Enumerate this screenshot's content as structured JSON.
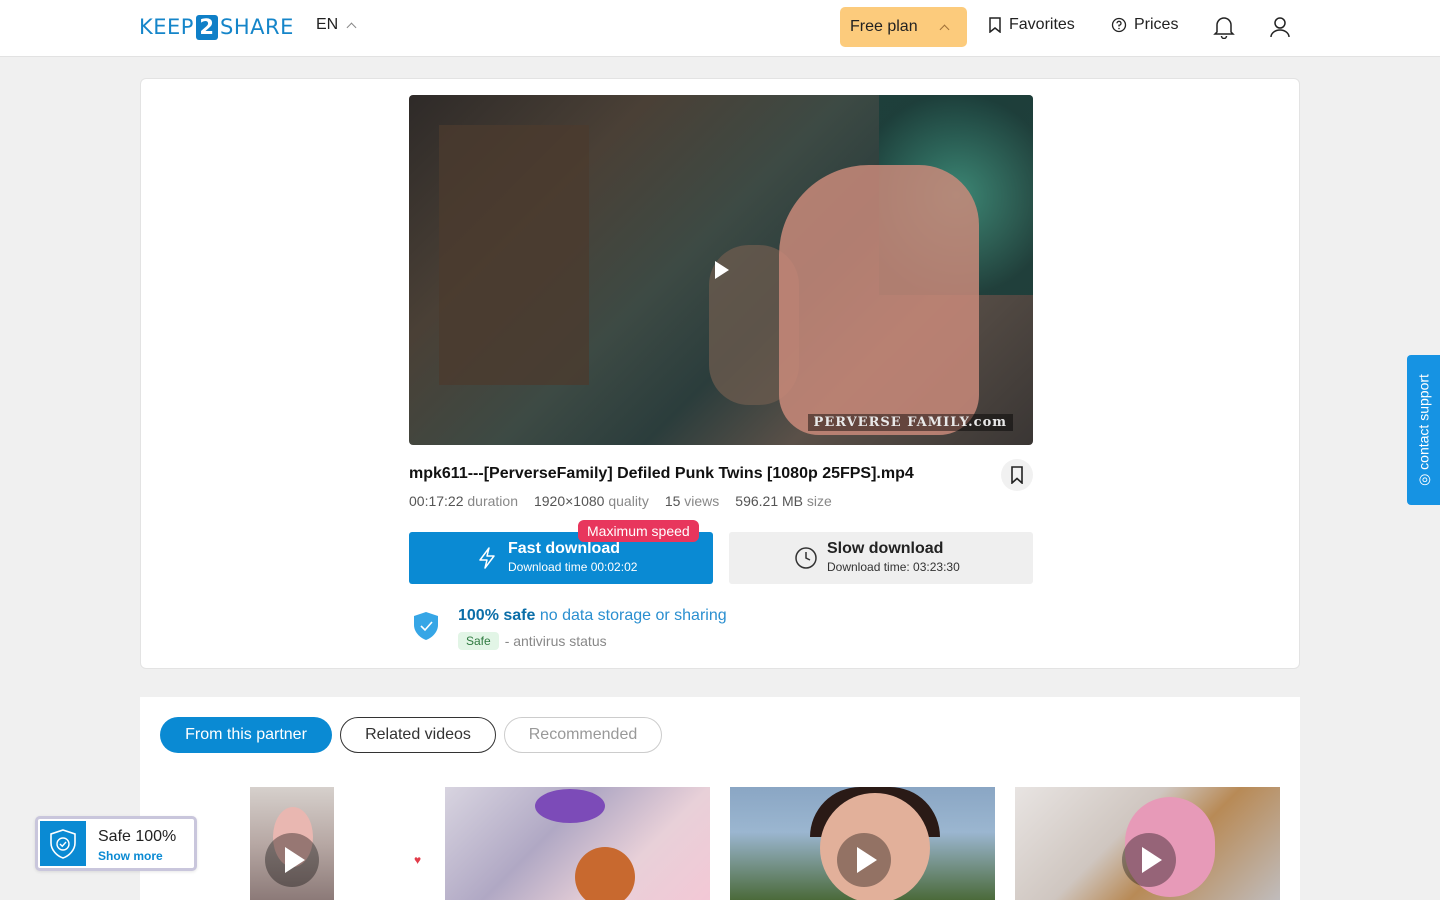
{
  "header": {
    "logo_left": "KEEP",
    "logo_mid": "2",
    "logo_right": "SHARE",
    "language": "EN",
    "plan_label": "Free plan",
    "favorites_label": "Favorites",
    "prices_label": "Prices"
  },
  "file": {
    "title": "mpk611---[PerverseFamily] Defiled Punk Twins [1080p 25FPS].mp4",
    "watermark": "PERVERSE FAMILY.com",
    "duration": "00:17:22",
    "duration_label": "duration",
    "resolution": "1920×1080",
    "resolution_label": "quality",
    "views": "15",
    "views_label": "views",
    "size": "596.21 MB",
    "size_label": "size"
  },
  "download": {
    "badge": "Maximum speed",
    "fast_label": "Fast download",
    "fast_time": "Download time 00:02:02",
    "slow_label": "Slow download",
    "slow_time": "Download time: 03:23:30"
  },
  "safety": {
    "strong": "100% safe",
    "rest": "no data storage or sharing",
    "tag": "Safe",
    "antivirus": "- antivirus status"
  },
  "tabs": [
    {
      "label": "From this partner"
    },
    {
      "label": "Related videos"
    },
    {
      "label": "Recommended"
    }
  ],
  "support": {
    "label": "◎ contact support"
  },
  "safe_widget": {
    "title": "Safe 100%",
    "link": "Show more"
  },
  "colors": {
    "accent": "#0a8ad3",
    "plan": "#fccb7c",
    "badge": "#e8365d"
  }
}
